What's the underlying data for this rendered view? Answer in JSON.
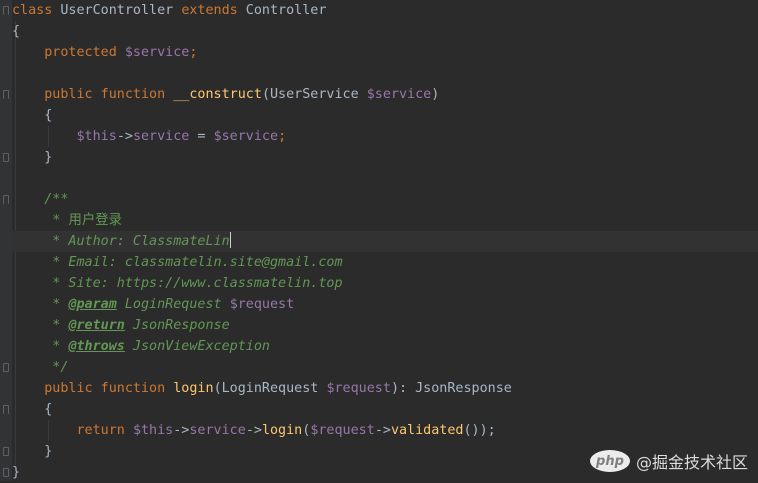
{
  "editor": {
    "lines": [
      {
        "tokens": [
          {
            "t": "class",
            "c": "kw"
          },
          {
            "t": " UserController ",
            "c": "plain"
          },
          {
            "t": "extends",
            "c": "kw"
          },
          {
            "t": " Controller",
            "c": "plain"
          }
        ]
      },
      {
        "tokens": [
          {
            "t": "{",
            "c": "plain"
          }
        ]
      },
      {
        "tokens": [
          {
            "t": "    protected ",
            "c": "kw"
          },
          {
            "t": "$service",
            "c": "var"
          },
          {
            "t": ";",
            "c": "kw"
          }
        ]
      },
      {
        "tokens": []
      },
      {
        "tokens": [
          {
            "t": "    public function ",
            "c": "kw"
          },
          {
            "t": "__construct",
            "c": "fn"
          },
          {
            "t": "(UserService ",
            "c": "plain"
          },
          {
            "t": "$service",
            "c": "var"
          },
          {
            "t": ")",
            "c": "plain"
          }
        ]
      },
      {
        "tokens": [
          {
            "t": "    {",
            "c": "plain"
          }
        ]
      },
      {
        "tokens": [
          {
            "t": "        $this",
            "c": "var"
          },
          {
            "t": "->",
            "c": "plain"
          },
          {
            "t": "service",
            "c": "var"
          },
          {
            "t": " = ",
            "c": "plain"
          },
          {
            "t": "$service",
            "c": "var"
          },
          {
            "t": ";",
            "c": "kw"
          }
        ]
      },
      {
        "tokens": [
          {
            "t": "    }",
            "c": "plain"
          }
        ]
      },
      {
        "tokens": []
      },
      {
        "tokens": [
          {
            "t": "    /**",
            "c": "doc"
          }
        ]
      },
      {
        "tokens": [
          {
            "t": "     * ",
            "c": "doc"
          },
          {
            "t": "用户登录",
            "c": "doc cjk"
          }
        ]
      },
      {
        "tokens": [
          {
            "t": "     * Author: ClassmateLin",
            "c": "doc"
          }
        ],
        "current": true,
        "caret": true
      },
      {
        "tokens": [
          {
            "t": "     * Email: classmatelin.site@gmail.com",
            "c": "doc"
          }
        ]
      },
      {
        "tokens": [
          {
            "t": "     * Site: https://www.classmatelin.top",
            "c": "doc"
          }
        ]
      },
      {
        "tokens": [
          {
            "t": "     * ",
            "c": "doc"
          },
          {
            "t": "@param",
            "c": "doctag"
          },
          {
            "t": " LoginRequest ",
            "c": "doc"
          },
          {
            "t": "$request",
            "c": "var"
          }
        ]
      },
      {
        "tokens": [
          {
            "t": "     * ",
            "c": "doc"
          },
          {
            "t": "@return",
            "c": "doctag"
          },
          {
            "t": " JsonResponse",
            "c": "doc"
          }
        ]
      },
      {
        "tokens": [
          {
            "t": "     * ",
            "c": "doc"
          },
          {
            "t": "@throws",
            "c": "doctag"
          },
          {
            "t": " JsonViewException",
            "c": "doc"
          }
        ]
      },
      {
        "tokens": [
          {
            "t": "     */",
            "c": "doc"
          }
        ]
      },
      {
        "tokens": [
          {
            "t": "    public function ",
            "c": "kw"
          },
          {
            "t": "login",
            "c": "fn"
          },
          {
            "t": "(LoginRequest ",
            "c": "plain"
          },
          {
            "t": "$request",
            "c": "var"
          },
          {
            "t": "): JsonResponse",
            "c": "plain"
          }
        ]
      },
      {
        "tokens": [
          {
            "t": "    {",
            "c": "plain"
          }
        ]
      },
      {
        "tokens": [
          {
            "t": "        return ",
            "c": "kw"
          },
          {
            "t": "$this",
            "c": "var"
          },
          {
            "t": "->",
            "c": "plain"
          },
          {
            "t": "service",
            "c": "var"
          },
          {
            "t": "->",
            "c": "plain"
          },
          {
            "t": "login",
            "c": "fn"
          },
          {
            "t": "(",
            "c": "plain"
          },
          {
            "t": "$request",
            "c": "var"
          },
          {
            "t": "->",
            "c": "plain"
          },
          {
            "t": "validated",
            "c": "fn"
          },
          {
            "t": "());",
            "c": "plain"
          }
        ]
      },
      {
        "tokens": [
          {
            "t": "    }",
            "c": "plain"
          }
        ]
      },
      {
        "tokens": [
          {
            "t": "}",
            "c": "plain"
          }
        ]
      }
    ]
  },
  "colors": {
    "background": "#2b2b2b",
    "keyword": "#cc7832",
    "variable": "#9876aa",
    "function": "#ffc66d",
    "doc_comment": "#629755",
    "plain": "#a9b7c6"
  },
  "watermark": {
    "badge": "php",
    "text": "@掘金技术社区"
  }
}
